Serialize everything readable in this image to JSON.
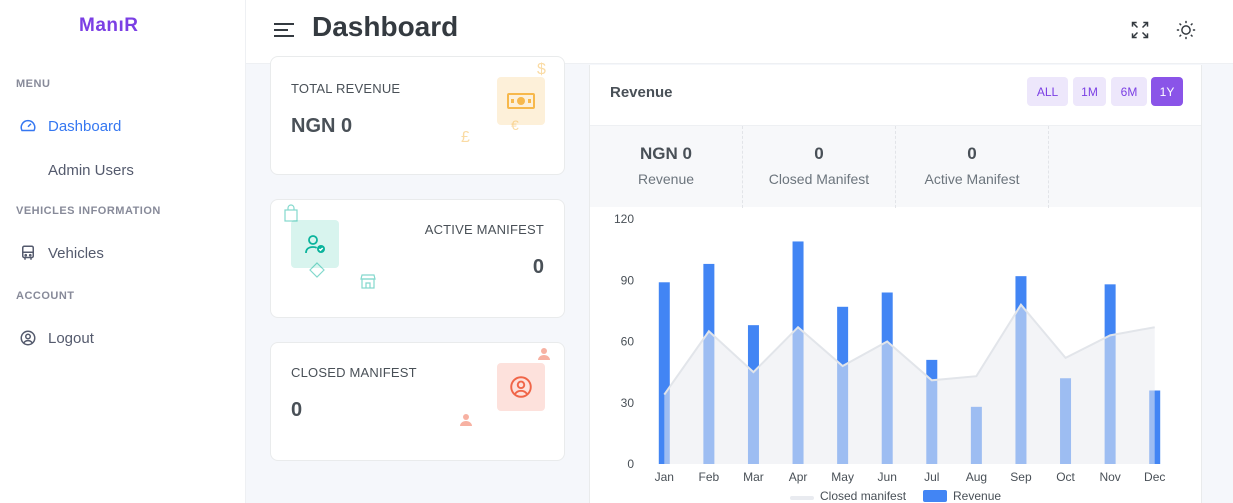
{
  "app": {
    "logo": "ManıR"
  },
  "sidebar": {
    "sections": [
      {
        "title": "MENU"
      },
      {
        "title": "VEHICLES INFORMATION"
      },
      {
        "title": "ACCOUNT"
      }
    ],
    "items": [
      {
        "label": "Dashboard",
        "icon": "speedometer-icon",
        "active": true
      },
      {
        "label": "Admin Users",
        "icon": "",
        "active": false
      },
      {
        "label": "Vehicles",
        "icon": "bus-icon",
        "active": false
      },
      {
        "label": "Logout",
        "icon": "user-circle-icon",
        "active": false
      }
    ]
  },
  "header": {
    "title": "Dashboard"
  },
  "cards": [
    {
      "label": "TOTAL REVENUE",
      "value": "NGN 0",
      "icon": "money-icon",
      "color": "#f7b84b"
    },
    {
      "label": "ACTIVE MANIFEST",
      "value": "0",
      "icon": "user-check-icon",
      "color": "#0ab39c"
    },
    {
      "label": "CLOSED MANIFEST",
      "value": "0",
      "icon": "user-circle-icon",
      "color": "#f06548"
    }
  ],
  "revenue": {
    "title": "Revenue",
    "ranges": [
      "ALL",
      "1M",
      "6M",
      "1Y"
    ],
    "selected_range": "1Y",
    "stats": [
      {
        "value": "NGN 0",
        "label": "Revenue"
      },
      {
        "value": "0",
        "label": "Closed Manifest"
      },
      {
        "value": "0",
        "label": "Active Manifest"
      }
    ]
  },
  "colors": {
    "accent": "#3577f1",
    "purple": "#7b3fe4",
    "bar": "#4285f4",
    "area": "#e9ebf0"
  },
  "chart_data": {
    "type": "bar",
    "categories": [
      "Jan",
      "Feb",
      "Mar",
      "Apr",
      "May",
      "Jun",
      "Jul",
      "Aug",
      "Sep",
      "Oct",
      "Nov",
      "Dec"
    ],
    "ylim": [
      0,
      120
    ],
    "yticks": [
      "0",
      "30",
      "60",
      "90",
      "120"
    ],
    "series": [
      {
        "name": "Revenue",
        "type": "bar",
        "values": [
          89,
          98,
          68,
          109,
          77,
          84,
          51,
          28,
          92,
          42,
          88,
          36
        ]
      },
      {
        "name": "Closed manifest",
        "type": "area",
        "values": [
          34,
          65,
          45,
          67,
          48,
          60,
          41,
          43,
          78,
          52,
          63,
          67
        ]
      }
    ],
    "legend": [
      "Closed manifest",
      "Revenue"
    ],
    "legend_position": "bottom"
  }
}
